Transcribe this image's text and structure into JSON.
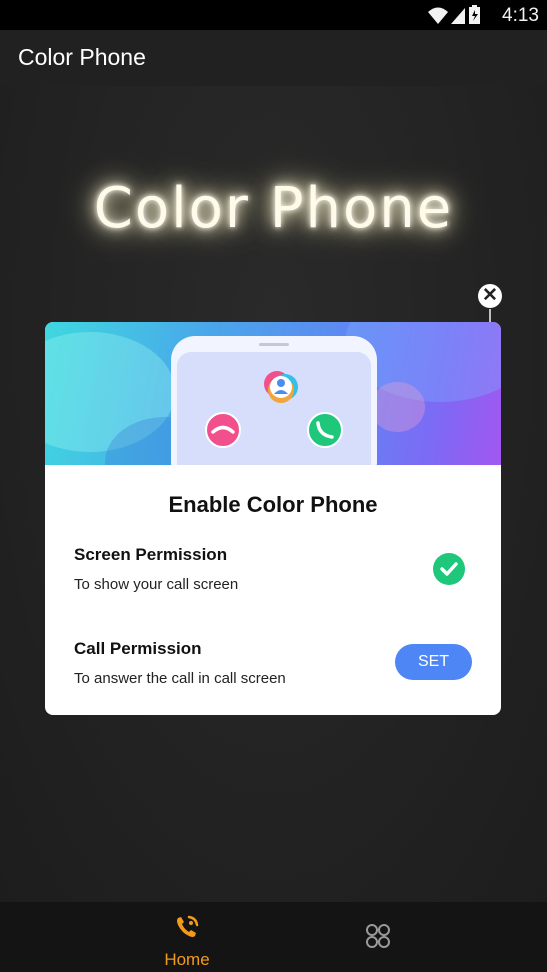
{
  "status_bar": {
    "time": "4:13",
    "icons": [
      "wifi-icon",
      "signal-icon",
      "battery-icon"
    ]
  },
  "app_bar": {
    "title": "Color Phone"
  },
  "hero": {
    "title": "Color Phone"
  },
  "dialog": {
    "title": "Enable Color Phone",
    "permissions": [
      {
        "title": "Screen Permission",
        "description": "To show your call screen",
        "status": "granted"
      },
      {
        "title": "Call Permission",
        "description": "To answer the call in call screen",
        "action_label": "SET"
      }
    ]
  },
  "bottom_nav": {
    "items": [
      {
        "label": "Home",
        "icon": "phone-call-icon",
        "active": true
      },
      {
        "label": "",
        "icon": "themes-grid-icon",
        "active": false
      }
    ]
  },
  "colors": {
    "accent_orange": "#f29a1a",
    "set_button_blue": "#4e86f5",
    "check_green": "#1fc77a",
    "reject_pink": "#f2508c",
    "accept_green": "#1fc77a"
  }
}
